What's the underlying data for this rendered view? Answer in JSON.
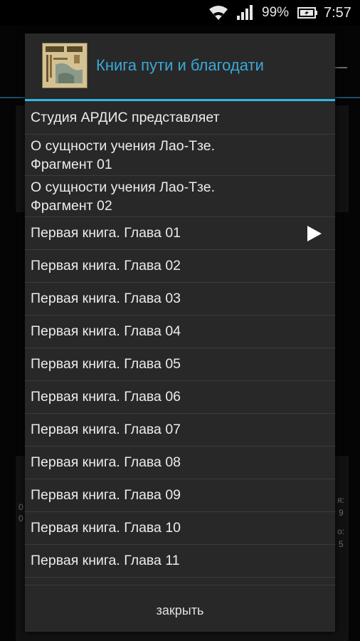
{
  "status_bar": {
    "battery_text": "99%",
    "time": "7:57",
    "icons": [
      "wifi-icon",
      "signal-icon",
      "battery-icon"
    ]
  },
  "background": {
    "side_texts": [
      "0",
      "0",
      "я:",
      "9",
      "о:",
      "5"
    ]
  },
  "dialog": {
    "title": "Книга пути и благодати",
    "title_color": "#39a9d8",
    "accent_color": "#33b5e5",
    "thumbnail_icon": "book-cover-icon",
    "items": [
      {
        "label": "Студия АРДИС представляет",
        "playing": false
      },
      {
        "label": "О сущности учения Лао-Тзе.\nФрагмент 01",
        "playing": false
      },
      {
        "label": "О сущности учения Лао-Тзе.\nФрагмент 02",
        "playing": false
      },
      {
        "label": "Первая книга. Глава 01",
        "playing": true
      },
      {
        "label": "Первая книга. Глава 02",
        "playing": false
      },
      {
        "label": "Первая книга. Глава 03",
        "playing": false
      },
      {
        "label": "Первая книга. Глава 04",
        "playing": false
      },
      {
        "label": "Первая книга. Глава 05",
        "playing": false
      },
      {
        "label": "Первая книга. Глава 06",
        "playing": false
      },
      {
        "label": "Первая книга. Глава 07",
        "playing": false
      },
      {
        "label": "Первая книга. Глава 08",
        "playing": false
      },
      {
        "label": "Первая книга. Глава 09",
        "playing": false
      },
      {
        "label": "Первая книга. Глава 10",
        "playing": false
      },
      {
        "label": "Первая книга. Глава 11",
        "playing": false
      }
    ],
    "close_label": "закрыть"
  }
}
